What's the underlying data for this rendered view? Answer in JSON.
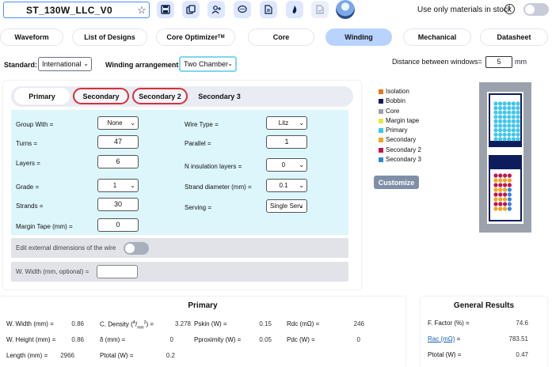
{
  "header": {
    "design_name": "ST_130W_LLC_V0",
    "stock_label": "Use only materials in stock",
    "info": "i"
  },
  "tabs": [
    {
      "label": "Waveform"
    },
    {
      "label": "List of Designs"
    },
    {
      "label": "Core Optimizer",
      "sup": "TM"
    },
    {
      "label": "Core"
    },
    {
      "label": "Winding"
    },
    {
      "label": "Mechanical"
    },
    {
      "label": "Datasheet"
    }
  ],
  "settings": {
    "standard_label": "Standard:",
    "standard_value": "International",
    "winding_label": "Winding arrangement:",
    "winding_value": "Two Chamber",
    "distance_label": "Distance between windows=",
    "distance_value": "5",
    "distance_unit": "mm"
  },
  "subtabs": [
    "Primary",
    "Secondary",
    "Secondary 2",
    "Secondary 3"
  ],
  "form": {
    "group_with_label": "Group With =",
    "group_with_value": "None",
    "turns_label": "Turns =",
    "turns_value": "47",
    "layers_label": "Layers =",
    "layers_value": "6",
    "grade_label": "Grade =",
    "grade_value": "1",
    "strands_label": "Strands =",
    "strands_value": "30",
    "margin_label": "Margin Tape (mm) =",
    "margin_value": "0",
    "wire_type_label": "Wire Type =",
    "wire_type_value": "Litz",
    "parallel_label": "Parallel =",
    "parallel_value": "1",
    "ins_layers_label": "N insulation layers =",
    "ins_layers_value": "0",
    "strand_dia_label": "Strand diameter (mm) =",
    "strand_dia_value": "0.1",
    "serving_label": "Serving =",
    "serving_value": "Single Serv",
    "edit_ext_label": "Edit external dimensions of the wire",
    "wwidth_label": "W. Width (mm, optional) =",
    "wwidth_value": ""
  },
  "legend": [
    {
      "label": "Isolation",
      "color": "#e8761c"
    },
    {
      "label": "Bobbin",
      "color": "#0d1d5c"
    },
    {
      "label": "Core",
      "color": "#9ba2ad"
    },
    {
      "label": "Margin tape",
      "color": "#ece53a"
    },
    {
      "label": "Primary",
      "color": "#40c6ec"
    },
    {
      "label": "Secondary",
      "color": "#f2a521"
    },
    {
      "label": "Secondary 2",
      "color": "#c0164f"
    },
    {
      "label": "Secondary 3",
      "color": "#2d86e0"
    }
  ],
  "customize_label": "Customize",
  "primary_results": {
    "title": "Primary",
    "rows": [
      [
        {
          "label": "W. Width (mm) =",
          "value": "0.86"
        },
        {
          "label": "C. Density (A/mm²) =",
          "value": "3.278"
        },
        {
          "label": "Pskin (W) =",
          "value": "0.15"
        },
        {
          "label": "Rdc (mΩ) =",
          "value": "246"
        }
      ],
      [
        {
          "label": "W. Height (mm) =",
          "value": "0.86"
        },
        {
          "label": "δ (mm) =",
          "value": "0"
        },
        {
          "label": "Pproximity (W) =",
          "value": "0.05"
        },
        {
          "label": "Pdc (W) =",
          "value": "0"
        }
      ],
      [
        {
          "label": "Length (mm) =",
          "value": "2966"
        },
        {
          "label": "Ptotal (W) =",
          "value": "0.2"
        }
      ]
    ]
  },
  "general_results": {
    "title": "General Results",
    "rows": [
      {
        "label": "F. Factor (%) =",
        "value": "74.6"
      },
      {
        "label": "Rac (mΩ)",
        "label_suffix": " =",
        "value": "783.51"
      },
      {
        "label": "Ptotal (W) =",
        "value": "0.47"
      }
    ]
  }
}
